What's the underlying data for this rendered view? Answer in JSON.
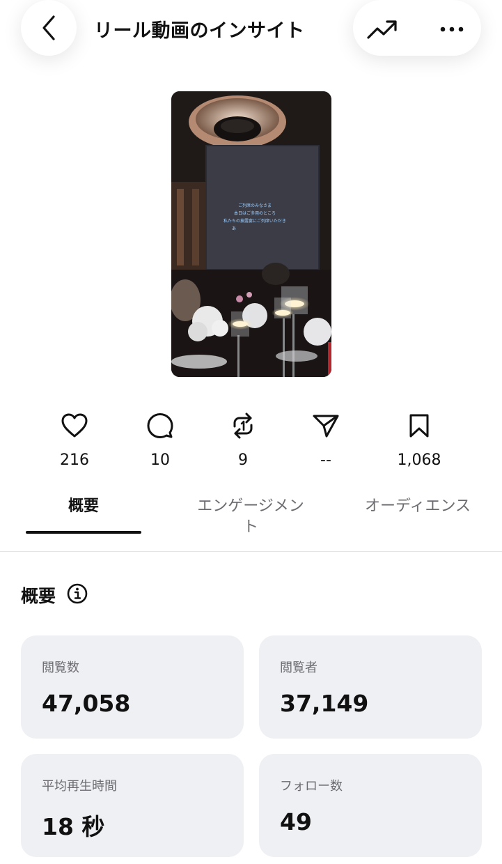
{
  "header": {
    "title": "リール動画のインサイト",
    "back_icon": "chevron-left-icon",
    "trend_icon": "trending-up-icon",
    "more_icon": "more-horizontal-icon"
  },
  "media": {
    "subtitle_lines": [
      "ご列席のみなさま",
      "本日はご多用のところ",
      "私たちの披露宴にご列席いただき",
      "あ"
    ]
  },
  "metrics": [
    {
      "icon": "heart-icon",
      "value": "216"
    },
    {
      "icon": "comment-icon",
      "value": "10"
    },
    {
      "icon": "repost-icon",
      "value": "9"
    },
    {
      "icon": "send-icon",
      "value": "--"
    },
    {
      "icon": "bookmark-icon",
      "value": "1,068"
    }
  ],
  "tabs": [
    {
      "label": "概要",
      "active": true
    },
    {
      "label": "エンゲージメン\nト",
      "line1": "エンゲージメン",
      "line2": "ト",
      "active": false
    },
    {
      "label": "オーディエンス",
      "active": false
    }
  ],
  "overview": {
    "title": "概要",
    "info_icon": "info-icon",
    "cards": [
      {
        "label": "閲覧数",
        "value": "47,058"
      },
      {
        "label": "閲覧者",
        "value": "37,149"
      },
      {
        "label": "平均再生時間",
        "value": "18 秒"
      },
      {
        "label": "フォロー数",
        "value": "49"
      }
    ]
  }
}
